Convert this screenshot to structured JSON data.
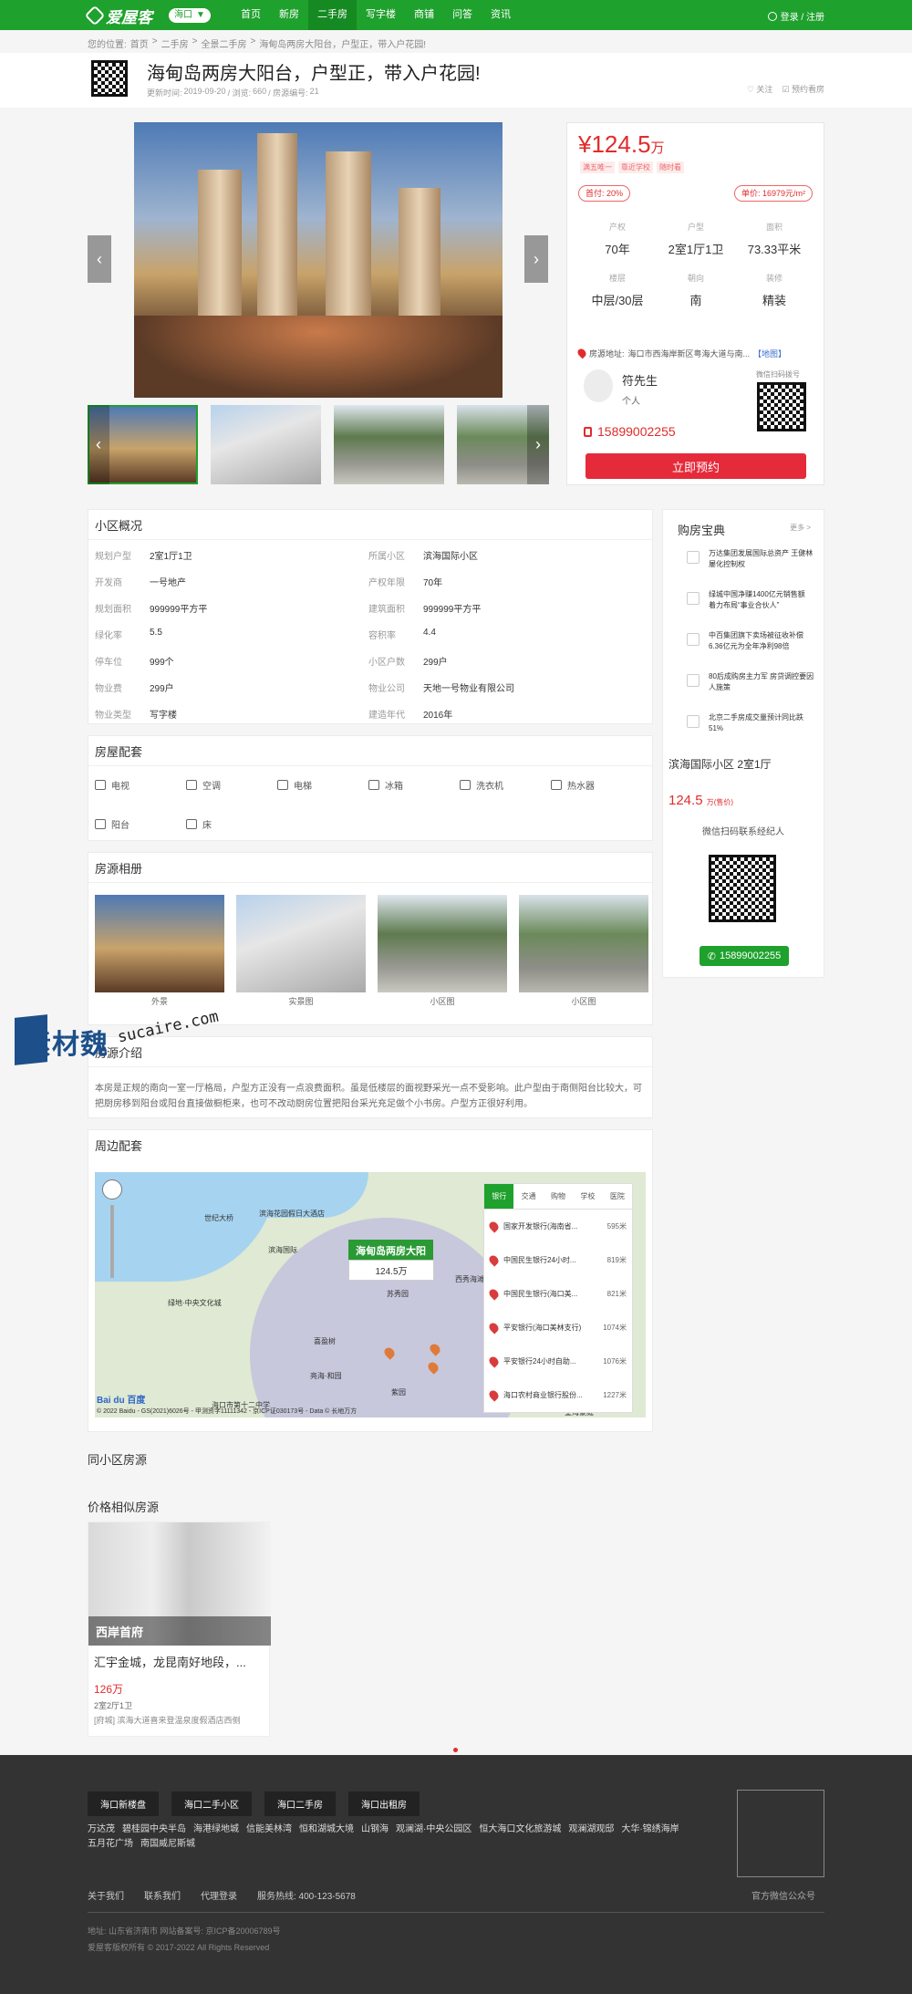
{
  "nav": {
    "logo": "爱屋客",
    "city": "海口",
    "items": [
      "首页",
      "新房",
      "二手房",
      "写字楼",
      "商铺",
      "问答",
      "资讯"
    ],
    "active_index": 2,
    "login": "登录 / 注册"
  },
  "breadcrumb": {
    "prefix": "您的位置:",
    "items": [
      "首页",
      ">",
      "二手房",
      ">",
      "全景二手房",
      ">",
      "海甸岛两房大阳台，户型正，带入户花园!"
    ]
  },
  "listing": {
    "title": "海甸岛两房大阳台，户型正，带入户花园!",
    "updated_label": "更新时间:",
    "updated": "2019-09-20",
    "views_label": "/ 浏览:",
    "views": "660",
    "id_label": "/ 房源编号:",
    "id": "21",
    "follow": "♡ 关注",
    "reserve": "☑ 预约看房"
  },
  "price": {
    "currency": "¥",
    "amount": "124.5",
    "unit": "万",
    "tags": [
      "满五唯一",
      "靠近学校",
      "随时看"
    ],
    "down_payment": "首付: 20%",
    "unit_price": "单价: 16979元/m²"
  },
  "props": [
    {
      "label": "产权",
      "value": "70年"
    },
    {
      "label": "户型",
      "value": "2室1厅1卫"
    },
    {
      "label": "面积",
      "value": "73.33平米"
    },
    {
      "label": "楼层",
      "value": "中层/30层"
    },
    {
      "label": "朝向",
      "value": "南"
    },
    {
      "label": "装修",
      "value": "精装"
    }
  ],
  "address": {
    "label": "房源地址:",
    "value": "海口市西海岸新区粤海大道与南...",
    "map_link": "【地图】"
  },
  "agent": {
    "name": "符先生",
    "type": "个人",
    "qr_label": "微信扫码拨号",
    "phone": "15899002255",
    "book_button": "立即预约"
  },
  "overview": {
    "title": "小区概况",
    "rows": [
      [
        "规划户型",
        "2室1厅1卫",
        "所属小区",
        "滨海国际小区"
      ],
      [
        "开发商",
        "一号地产",
        "产权年限",
        "70年"
      ],
      [
        "规划面积",
        "999999平方平",
        "建筑面积",
        "999999平方平"
      ],
      [
        "绿化率",
        "5.5",
        "容积率",
        "4.4"
      ],
      [
        "停车位",
        "999个",
        "小区户数",
        "299户"
      ],
      [
        "物业费",
        "299户",
        "物业公司",
        "天地一号物业有限公司"
      ],
      [
        "物业类型",
        "写字楼",
        "建造年代",
        "2016年"
      ]
    ]
  },
  "facilities": {
    "title": "房屋配套",
    "items": [
      {
        "icon": "tv-icon",
        "label": "电视"
      },
      {
        "icon": "air-conditioner-icon",
        "label": "空调"
      },
      {
        "icon": "elevator-icon",
        "label": "电梯"
      },
      {
        "icon": "fridge-icon",
        "label": "冰箱"
      },
      {
        "icon": "washer-icon",
        "label": "洗衣机"
      },
      {
        "icon": "water-heater-icon",
        "label": "热水器"
      },
      {
        "icon": "balcony-icon",
        "label": "阳台"
      },
      {
        "icon": "bed-icon",
        "label": "床"
      }
    ]
  },
  "album": {
    "title": "房源相册",
    "items": [
      {
        "caption": "外景"
      },
      {
        "caption": "实景图"
      },
      {
        "caption": "小区图"
      },
      {
        "caption": "小区图"
      }
    ]
  },
  "intro": {
    "title": "房源介绍",
    "text": "本房是正规的南向一室一厅格局，户型方正没有一点浪费面积。虽是低楼层的面视野采光一点不受影响。此户型由于南侧阳台比较大，可把厨房移到阳台或阳台直接做橱柜来，也可不改动厨房位置把阳台采光充足做个小书房。户型方正很好利用。"
  },
  "surroundings": {
    "title": "周边配套",
    "marker_name": "海甸岛两房大阳",
    "marker_price": "124.5万",
    "tabs": [
      "银行",
      "交通",
      "购物",
      "学校",
      "医院"
    ],
    "active_tab": 0,
    "pois": [
      {
        "name": "国家开发银行(海南省...",
        "dist": "595米"
      },
      {
        "name": "中国民生银行24小时...",
        "dist": "819米"
      },
      {
        "name": "中国民生银行(海口美...",
        "dist": "821米"
      },
      {
        "name": "平安银行(海口美林支行)",
        "dist": "1074米"
      },
      {
        "name": "平安银行24小时自助...",
        "dist": "1076米"
      },
      {
        "name": "海口农村商业银行股份...",
        "dist": "1227米"
      }
    ],
    "map_labels": [
      "世纪大桥",
      "滨海国际",
      "苏秀园",
      "西秀海滩",
      "绿地·中央文化城",
      "喜盈树",
      "亮海·和园",
      "海口市第十二中学",
      "望海豪庭",
      "紫园",
      "滨海花园假日大酒店"
    ],
    "copyright": "© 2022 Baidu - GS(2021)6026号 - 甲测资字11111342 - 京ICP证030173号 - Data © 长地万方",
    "baidu": "Bai du 百度"
  },
  "sidebar": {
    "title": "购房宝典",
    "more": "更多 >",
    "news": [
      "万达集团发展国际总资产 王健林屡化控制权",
      "绿城中国净赚1400亿元销售额 着力布局“事业合伙人”",
      "中百集团旗下卖场被征收补偿6.36亿元为全年净利98倍",
      "80后成购房主力军 房贷调控要因人施策",
      "北京二手房成交量预计同比跌51%"
    ],
    "house_name": "滨海国际小区 2室1厅",
    "house_price": "124.5",
    "house_price_unit": "万(售价)",
    "qr_label": "微信扫码联系经纪人",
    "phone": "15899002255"
  },
  "same_community": {
    "title": "同小区房源"
  },
  "similar": {
    "title": "价格相似房源",
    "overlay": "西岸首府",
    "card_title": "汇宇金城，龙昆南好地段，...",
    "price": "126万",
    "layout": "2室2厅1卫",
    "address": "[府城] 滨海大道喜来登温泉度假酒店西侧"
  },
  "watermark": {
    "cn": "素材魏",
    "en": "sucaire.com"
  },
  "footer": {
    "buttons": [
      "海口新楼盘",
      "海口二手小区",
      "海口二手房",
      "海口出租房"
    ],
    "links": [
      "万达茂",
      "碧桂园中央半岛",
      "海港绿地城",
      "信能美林湾",
      "恒和湖城大境",
      "山钢海",
      "观澜湖·中央公园区",
      "恒大海口文化旅游城",
      "观澜湖观邸",
      "大华·锦绣海岸",
      "五月花广场",
      "南国威尼斯城"
    ],
    "qr_label": "官方微信公众号",
    "nav": [
      "关于我们",
      "联系我们",
      "代理登录",
      "服务热线: 400-123-5678"
    ],
    "address_line": "地址: 山东省济南市 网站备案号: 京ICP备20006789号",
    "copyright": "爱屋客版权所有 © 2017-2022 All Rights Reserved"
  }
}
